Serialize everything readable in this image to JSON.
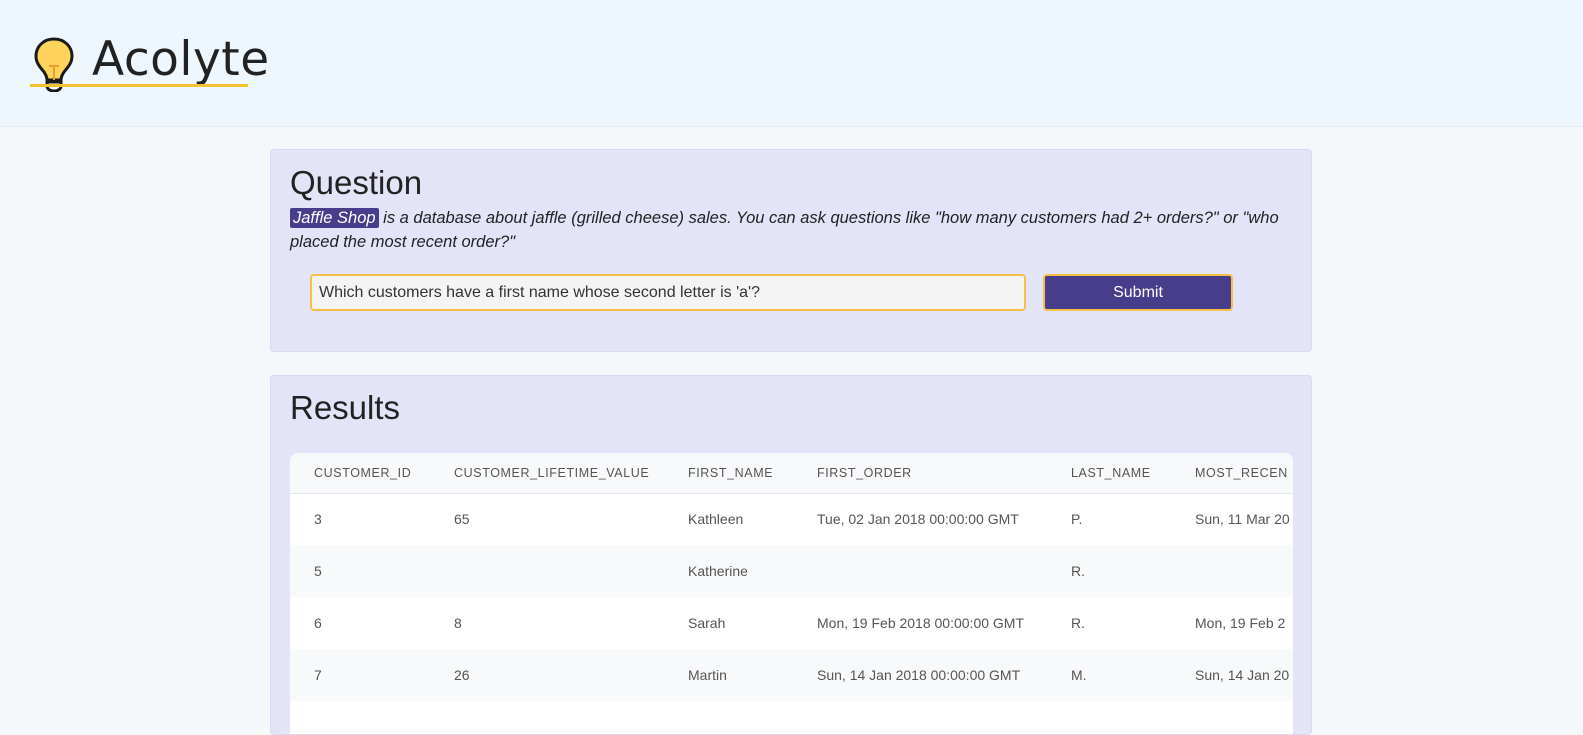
{
  "app": {
    "name": "Acolyte",
    "accent_color": "#f4c430",
    "brand_color": "#483d8b"
  },
  "question_panel": {
    "heading": "Question",
    "database_name": "Jaffle Shop",
    "description": " is a database about jaffle (grilled cheese) sales. You can ask questions like \"how many customers had 2+ orders?\" or \"who placed the most recent order?\"",
    "input_value": "Which customers have a first name whose second letter is 'a'?",
    "submit_label": "Submit"
  },
  "results_panel": {
    "heading": "Results",
    "columns": [
      "CUSTOMER_ID",
      "CUSTOMER_LIFETIME_VALUE",
      "FIRST_NAME",
      "FIRST_ORDER",
      "LAST_NAME",
      "MOST_RECEN"
    ],
    "rows": [
      [
        "3",
        "65",
        "Kathleen",
        "Tue, 02 Jan 2018 00:00:00 GMT",
        "P.",
        "Sun, 11 Mar 20"
      ],
      [
        "5",
        "",
        "Katherine",
        "",
        "R.",
        ""
      ],
      [
        "6",
        "8",
        "Sarah",
        "Mon, 19 Feb 2018 00:00:00 GMT",
        "R.",
        "Mon, 19 Feb 2"
      ],
      [
        "7",
        "26",
        "Martin",
        "Sun, 14 Jan 2018 00:00:00 GMT",
        "M.",
        "Sun, 14 Jan 20"
      ]
    ]
  }
}
